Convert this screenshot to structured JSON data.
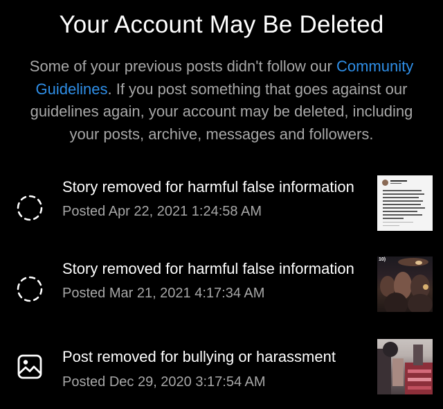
{
  "header": {
    "title": "Your Account May Be Deleted"
  },
  "description": {
    "part1": "Some of your previous posts didn't follow our ",
    "link": "Community Guidelines",
    "part2": ". If you post something that goes against our guidelines again, your account may be deleted, including your posts, archive, messages and followers."
  },
  "items": [
    {
      "label": "Story removed for harmful false information",
      "date": "Posted Apr 22, 2021 1:24:58 AM",
      "icon": "story-ring-icon"
    },
    {
      "label": "Story removed for harmful false information",
      "date": "Posted Mar 21, 2021 4:17:34 AM",
      "icon": "story-ring-icon"
    },
    {
      "label": "Post removed for bullying or harassment",
      "date": "Posted Dec 29, 2020 3:17:54 AM",
      "icon": "image-icon"
    }
  ],
  "thumbnail_caption": "10)",
  "colors": {
    "background": "#000000",
    "text_primary": "#ffffff",
    "text_secondary": "#a8a8a8",
    "link": "#2f8fe8"
  }
}
